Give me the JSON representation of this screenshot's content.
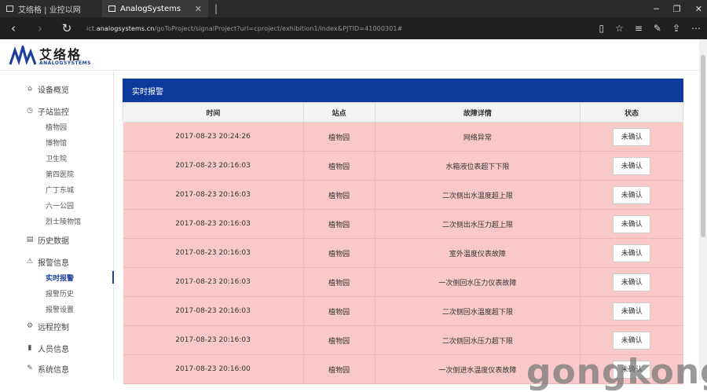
{
  "browser": {
    "tabs": [
      {
        "title": "艾络格 | 业控以网",
        "active": false
      },
      {
        "title": "AnalogSystems",
        "active": true
      }
    ],
    "url_prefix": "ict.",
    "url_host": "analogsystems.cn",
    "url_path": "/goToProject/signalProject?url=cproject/exhibition1/index&PJTID=41000301#"
  },
  "brand": {
    "name_cn": "艾络格",
    "name_en": "ANALOGSYSTEMS"
  },
  "sidebar": {
    "items": [
      {
        "label": "设备概览",
        "icon": "home-icon",
        "glyph": "⌂"
      },
      {
        "label": "子站监控",
        "icon": "clock-icon",
        "glyph": "◷",
        "children": [
          "植物园",
          "博物馆",
          "卫生院",
          "第四医院",
          "广丁东城",
          "六一公园",
          "烈士陵物馆"
        ]
      },
      {
        "label": "历史数据",
        "icon": "document-icon",
        "glyph": "▤"
      },
      {
        "label": "报警信息",
        "icon": "warning-icon",
        "glyph": "⚠",
        "children": [
          "实时报警",
          "报警历史",
          "报警设置"
        ]
      },
      {
        "label": "远程控制",
        "icon": "gear-icon",
        "glyph": "⚙"
      },
      {
        "label": "人员信息",
        "icon": "bookmark-icon",
        "glyph": "▮"
      },
      {
        "label": "系统信息",
        "icon": "info-icon",
        "glyph": "✎"
      }
    ],
    "active_child": "实时报警"
  },
  "alarm_panel": {
    "title": "实时报警",
    "columns": [
      "时间",
      "站点",
      "故障详情",
      "状态"
    ],
    "rows": [
      {
        "time": "2017-08-23 20:24:26",
        "site": "植物园",
        "detail": "网络异常",
        "status": "未确认"
      },
      {
        "time": "2017-08-23 20:16:03",
        "site": "植物园",
        "detail": "水箱液位表超下下限",
        "status": "未确认"
      },
      {
        "time": "2017-08-23 20:16:03",
        "site": "植物园",
        "detail": "二次侧出水温度超上限",
        "status": "未确认"
      },
      {
        "time": "2017-08-23 20:16:03",
        "site": "植物园",
        "detail": "二次侧出水压力超上限",
        "status": "未确认"
      },
      {
        "time": "2017-08-23 20:16:03",
        "site": "植物园",
        "detail": "室外温度仪表故障",
        "status": "未确认"
      },
      {
        "time": "2017-08-23 20:16:03",
        "site": "植物园",
        "detail": "一次侧回水压力仪表故障",
        "status": "未确认"
      },
      {
        "time": "2017-08-23 20:16:03",
        "site": "植物园",
        "detail": "二次侧回水温度超下限",
        "status": "未确认"
      },
      {
        "time": "2017-08-23 20:16:03",
        "site": "植物园",
        "detail": "二次侧回水压力超下限",
        "status": "未确认"
      },
      {
        "time": "2017-08-23 20:16:00",
        "site": "植物园",
        "detail": "一次侧进水温度仪表故障",
        "status": "未确认"
      }
    ]
  },
  "watermark": "gongkong"
}
